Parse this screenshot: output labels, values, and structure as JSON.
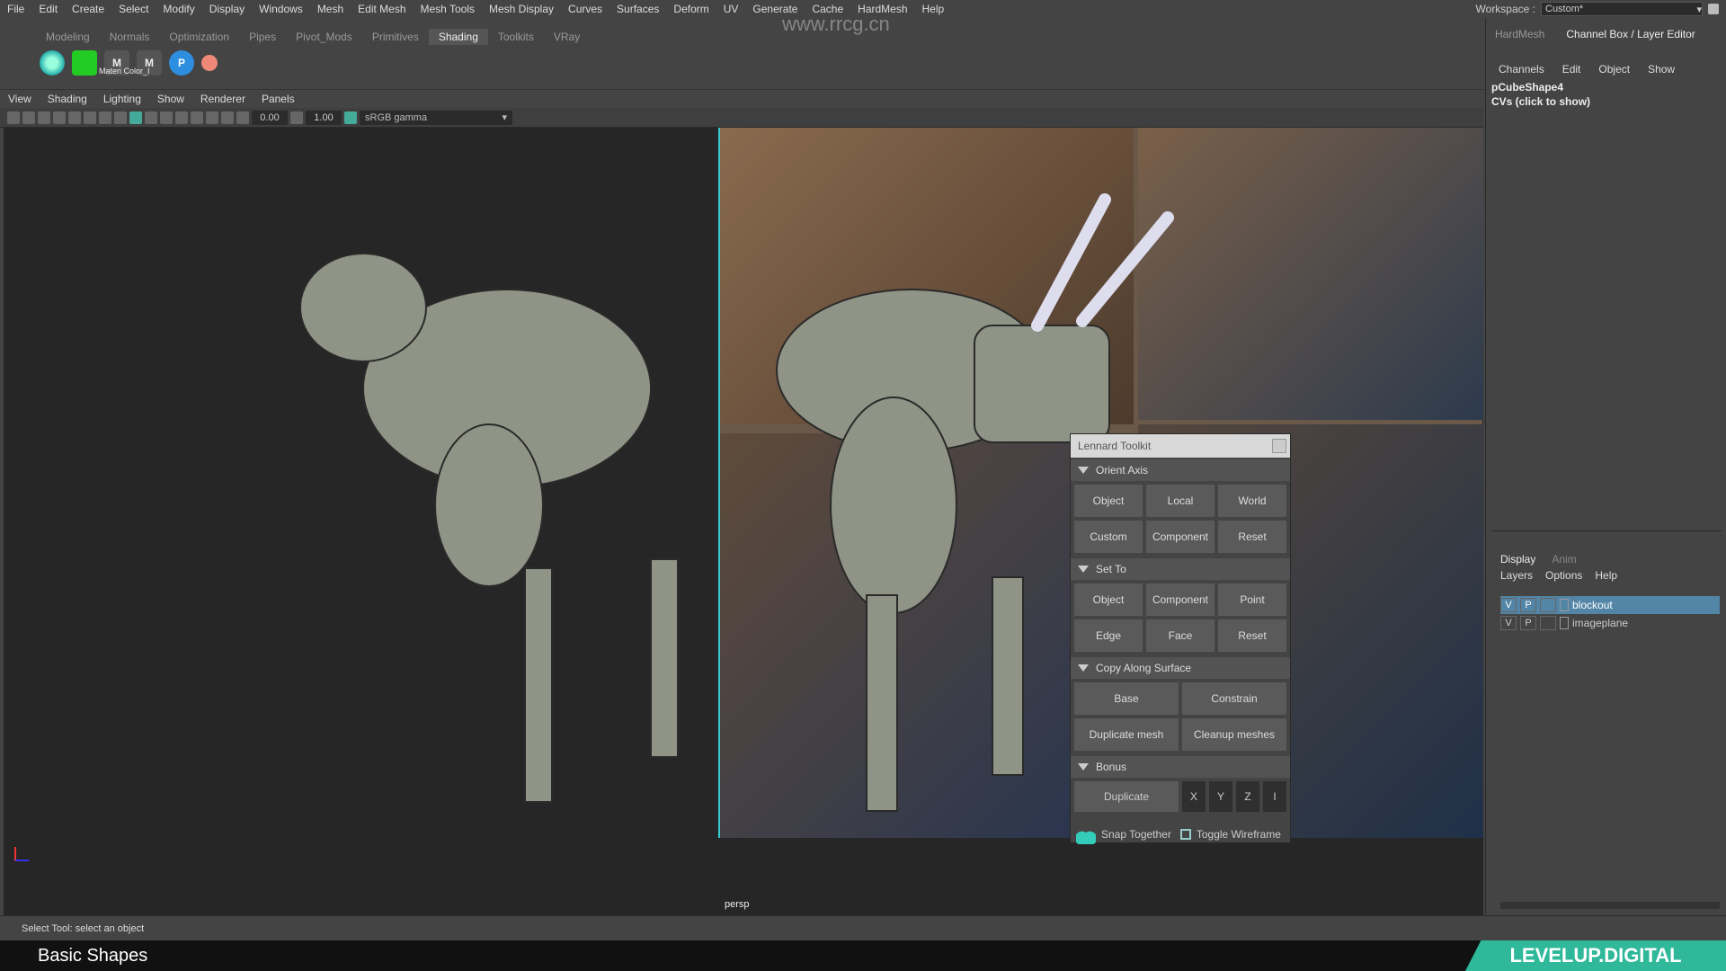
{
  "menubar": {
    "items": [
      "File",
      "Edit",
      "Create",
      "Select",
      "Modify",
      "Display",
      "Windows",
      "Mesh",
      "Edit Mesh",
      "Mesh Tools",
      "Mesh Display",
      "Curves",
      "Surfaces",
      "Deform",
      "UV",
      "Generate",
      "Cache",
      "HardMesh",
      "Help"
    ]
  },
  "workspace": {
    "label": "Workspace :",
    "value": "Custom*"
  },
  "shelf": {
    "tabs": [
      "Modeling",
      "Normals",
      "Optimization",
      "Pipes",
      "Pivot_Mods",
      "Primitives",
      "Shading",
      "Toolkits",
      "VRay"
    ],
    "active": "Shading",
    "icon_label": "Materi Color_I"
  },
  "viewport_menu": [
    "View",
    "Shading",
    "Lighting",
    "Show",
    "Renderer",
    "Panels"
  ],
  "viewport_toolbar": {
    "value_a": "0.00",
    "value_b": "1.00",
    "color_space": "sRGB gamma"
  },
  "right_panel": {
    "tabs": [
      "HardMesh",
      "Channel Box / Layer Editor"
    ],
    "menu": [
      "Channels",
      "Edit",
      "Object",
      "Show"
    ],
    "object_name": "pCubeShape4",
    "hint": "CVs (click to show)",
    "layer_tabs": [
      "Display",
      "Anim"
    ],
    "layer_menu": [
      "Layers",
      "Options",
      "Help"
    ],
    "layers": [
      {
        "v": "V",
        "p": "P",
        "name": "blockout"
      },
      {
        "v": "V",
        "p": "P",
        "name": "imageplane"
      }
    ]
  },
  "toolkit": {
    "title": "Lennard Toolkit",
    "sections": {
      "orient_axis": {
        "title": "Orient Axis",
        "buttons": [
          "Object",
          "Local",
          "World",
          "Custom",
          "Component",
          "Reset"
        ]
      },
      "set_to": {
        "title": "Set To",
        "buttons": [
          "Object",
          "Component",
          "Point",
          "Edge",
          "Face",
          "Reset"
        ]
      },
      "copy_along_surface": {
        "title": "Copy Along Surface",
        "buttons": [
          "Base",
          "Constrain",
          "Duplicate mesh",
          "Cleanup meshes"
        ]
      },
      "bonus": {
        "title": "Bonus",
        "duplicate": "Duplicate",
        "axes": [
          "X",
          "Y",
          "Z",
          "I"
        ]
      }
    },
    "snap_together": "Snap Together",
    "toggle_wireframe": "Toggle Wireframe"
  },
  "viewport": {
    "camera": "persp"
  },
  "status": {
    "text": "Select Tool: select an object"
  },
  "lower_third": "Basic Shapes",
  "brand": "LEVELUP.DIGITAL",
  "watermark_url": "www.rrcg.cn"
}
